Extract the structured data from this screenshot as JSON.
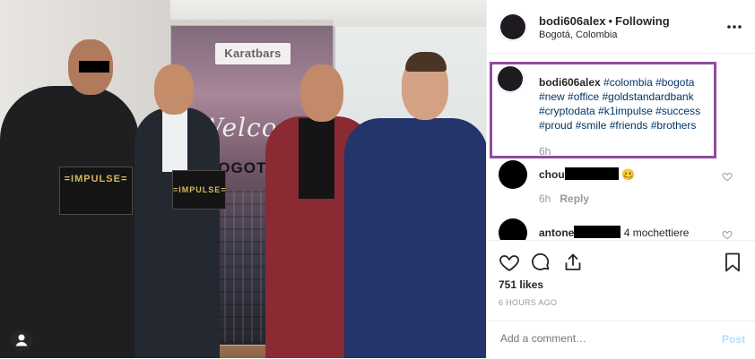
{
  "photo": {
    "banner_logo": "Karatbars",
    "banner_welcome": "Welcome",
    "banner_city": "BOGOTA",
    "box_label_1": "=IMPULSE=",
    "box_label_2": "=IMPULSE="
  },
  "header": {
    "username": "bodi606alex",
    "separator": "•",
    "follow_state": "Following",
    "location": "Bogotá, Colombia",
    "more_icon": "more-options-icon"
  },
  "caption": {
    "username": "bodi606alex",
    "text": "#colombia #bogota #new #office #goldstandardbank #cryptodata #k1impulse #success #proud #smile #friends #brothers",
    "time": "6h"
  },
  "comments": [
    {
      "name_prefix": "chou",
      "text": "🥴",
      "time": "6h",
      "reply_label": "Reply"
    },
    {
      "name_prefix": "antone",
      "text": "4 mochettiere",
      "time": "",
      "reply_label": ""
    }
  ],
  "actions": {
    "likes": "751 likes",
    "time_ago": "6 HOURS AGO"
  },
  "add_comment": {
    "placeholder": "Add a comment…",
    "post_label": "Post"
  },
  "colors": {
    "highlight_border": "#8e4d9f",
    "link": "#003569",
    "muted": "#999999",
    "post_disabled": "#b2dffc"
  }
}
